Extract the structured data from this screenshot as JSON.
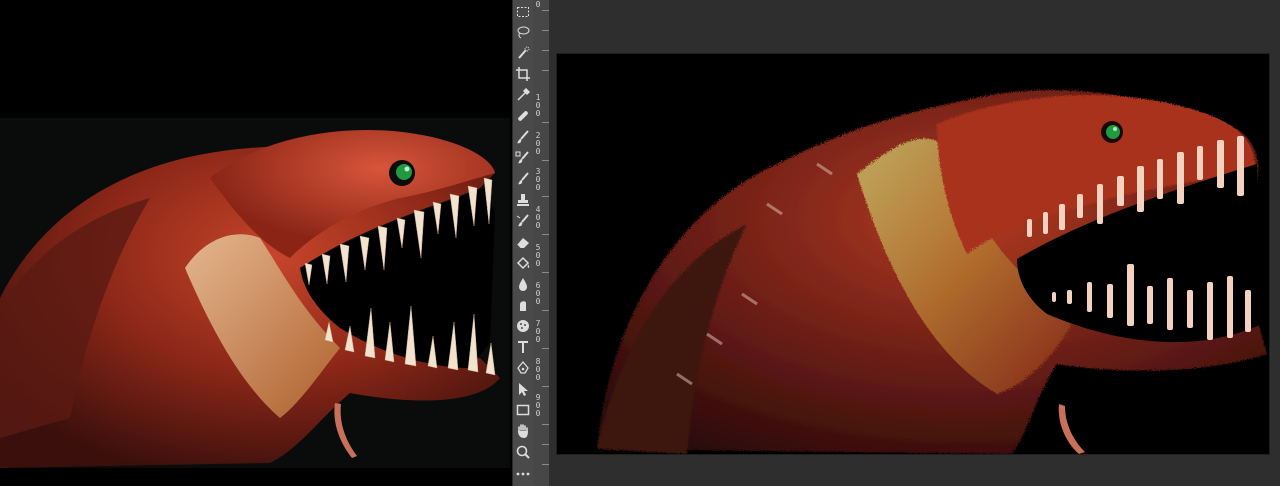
{
  "toolbar": {
    "tools": [
      {
        "icon": "rectangular-marquee-icon"
      },
      {
        "icon": "lasso-icon"
      },
      {
        "icon": "quick-selection-icon"
      },
      {
        "icon": "crop-icon"
      },
      {
        "icon": "eyedropper-icon"
      },
      {
        "icon": "healing-brush-icon"
      },
      {
        "icon": "brush-icon"
      },
      {
        "icon": "mixer-brush-icon"
      },
      {
        "icon": "history-brush-icon"
      },
      {
        "icon": "clone-stamp-icon"
      },
      {
        "icon": "art-history-brush-icon"
      },
      {
        "icon": "eraser-icon"
      },
      {
        "icon": "paint-bucket-icon"
      },
      {
        "icon": "blur-icon"
      },
      {
        "icon": "smudge-icon"
      },
      {
        "icon": "sponge-icon"
      },
      {
        "icon": "type-icon"
      },
      {
        "icon": "pen-icon"
      },
      {
        "icon": "path-selection-icon"
      },
      {
        "icon": "rectangle-shape-icon"
      },
      {
        "icon": "hand-icon"
      },
      {
        "icon": "zoom-icon"
      },
      {
        "icon": "more-tools-icon"
      }
    ]
  },
  "ruler": {
    "labels": [
      "0",
      "1",
      "0",
      "0",
      "2",
      "0",
      "0",
      "3",
      "0",
      "0",
      "4",
      "0",
      "0",
      "5",
      "0",
      "0",
      "6",
      "0",
      "0",
      "7",
      "0",
      "0",
      "8",
      "0",
      "0",
      "9",
      "0",
      "0"
    ]
  },
  "colors": {
    "toolbar_bg": "#4a4a4a",
    "workspace_bg": "#2e2e2e",
    "canvas_bg": "#000000",
    "fish_red": "#a3311c",
    "fish_dark": "#4a1512",
    "teeth": "#f3d3c0",
    "eye": "#1f9a43"
  }
}
